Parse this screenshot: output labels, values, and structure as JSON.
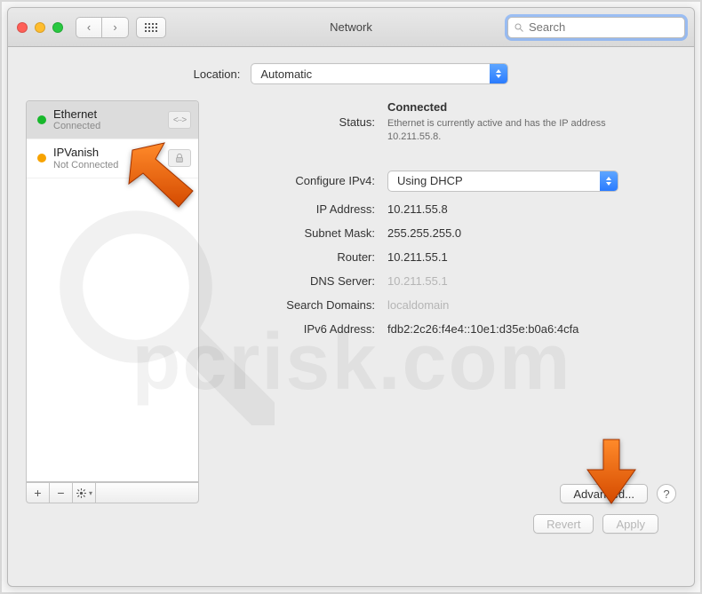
{
  "window": {
    "title": "Network"
  },
  "toolbar": {
    "search_placeholder": "Search"
  },
  "location": {
    "label": "Location:",
    "selected": "Automatic"
  },
  "sidebar": {
    "items": [
      {
        "name": "Ethernet",
        "state": "Connected",
        "status_color": "green",
        "type_icon": "ethernet-icon",
        "selected": true
      },
      {
        "name": "IPVanish",
        "state": "Not Connected",
        "status_color": "amber",
        "type_icon": "vpn-lock-icon",
        "selected": false
      }
    ],
    "footer": {
      "add_label": "+",
      "remove_label": "−"
    }
  },
  "details": {
    "status_label": "Status:",
    "status_value": "Connected",
    "status_description": "Ethernet is currently active and has the IP address 10.211.55.8.",
    "configure_label": "Configure IPv4:",
    "configure_value": "Using DHCP",
    "fields": [
      {
        "label": "IP Address:",
        "value": "10.211.55.8",
        "muted": false
      },
      {
        "label": "Subnet Mask:",
        "value": "255.255.255.0",
        "muted": false
      },
      {
        "label": "Router:",
        "value": "10.211.55.1",
        "muted": false
      },
      {
        "label": "DNS Server:",
        "value": "10.211.55.1",
        "muted": true
      },
      {
        "label": "Search Domains:",
        "value": "localdomain",
        "muted": true
      },
      {
        "label": "IPv6 Address:",
        "value": "fdb2:2c26:f4e4::10e1:d35e:b0a6:4cfa",
        "muted": false
      }
    ],
    "advanced_label": "Advanced...",
    "help_label": "?"
  },
  "footer": {
    "revert_label": "Revert",
    "apply_label": "Apply"
  },
  "watermark": {
    "text": "pcrisk.com"
  }
}
